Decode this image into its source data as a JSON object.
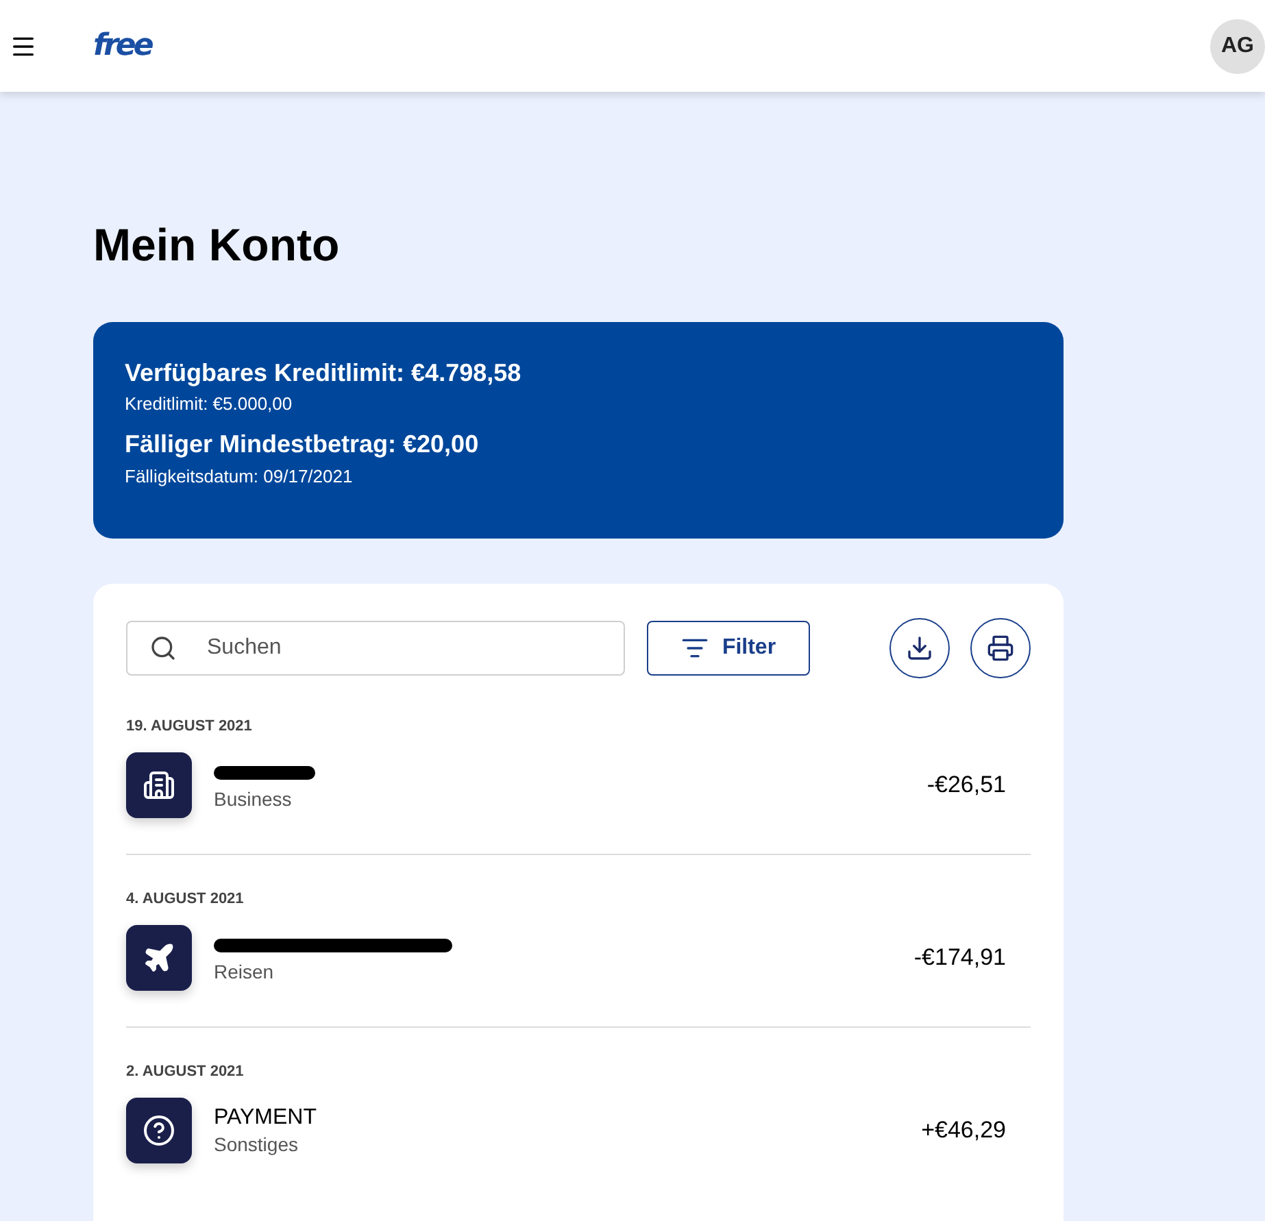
{
  "header": {
    "logo": "free",
    "avatar": "AG"
  },
  "page_title": "Mein Konto",
  "summary": {
    "available_limit": "Verfügbares Kreditlimit: €4.798,58",
    "limit": "Kreditlimit: €5.000,00",
    "minimum_due": "Fälliger Mindestbetrag: €20,00",
    "due_date": "Fälligkeitsdatum: 09/17/2021"
  },
  "toolbar": {
    "search": {
      "placeholder": "Suchen"
    },
    "filter_button": "Filter"
  },
  "transactions": [
    {
      "date": "19. AUGUST 2021",
      "kind": "business",
      "redacted": true,
      "category": "Business",
      "amount": "-€26,51"
    },
    {
      "date": "4. AUGUST 2021",
      "kind": "travel",
      "redacted": true,
      "category": "Reisen",
      "amount": "-€174,91"
    },
    {
      "date": "2. AUGUST 2021",
      "kind": "other",
      "redacted": false,
      "name": "PAYMENT",
      "category": "Sonstiges",
      "amount": "+€46,29"
    }
  ]
}
